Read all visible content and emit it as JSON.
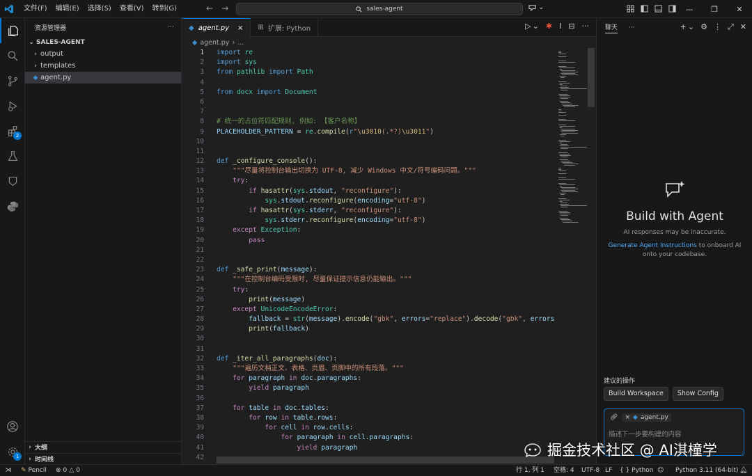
{
  "titlebar": {
    "menus": [
      "文件(F)",
      "编辑(E)",
      "选择(S)",
      "查看(V)",
      "转到(G)"
    ],
    "search_text": "sales-agent",
    "window_controls": [
      "minimize",
      "restore",
      "close"
    ]
  },
  "activitybar": {
    "items": [
      "explorer",
      "search",
      "source-control",
      "run-debug",
      "extensions",
      "testing",
      "remote",
      "python"
    ],
    "extensions_badge": "2",
    "accounts_badge": "1"
  },
  "sidebar": {
    "title": "资源管理器",
    "more": "···",
    "root": "SALES-AGENT",
    "items": [
      {
        "label": "output",
        "type": "folder"
      },
      {
        "label": "templates",
        "type": "folder"
      },
      {
        "label": "agent.py",
        "type": "file"
      }
    ],
    "outline_label": "大纲",
    "timeline_label": "时间线"
  },
  "editor": {
    "tabs": [
      {
        "label": "agent.py",
        "active": true,
        "close": "×"
      },
      {
        "label": "扩展: Python",
        "active": false
      }
    ],
    "breadcrumb": [
      "agent.py",
      "›",
      "..."
    ],
    "code_lines": [
      [
        [
          "kw",
          "import"
        ],
        [
          "p",
          " "
        ],
        [
          "cls",
          "re"
        ]
      ],
      [
        [
          "kw",
          "import"
        ],
        [
          "p",
          " "
        ],
        [
          "cls",
          "sys"
        ]
      ],
      [
        [
          "kw",
          "from"
        ],
        [
          "p",
          " "
        ],
        [
          "cls",
          "pathlib"
        ],
        [
          "p",
          " "
        ],
        [
          "kw",
          "import"
        ],
        [
          "p",
          " "
        ],
        [
          "cls",
          "Path"
        ]
      ],
      [],
      [
        [
          "kw",
          "from"
        ],
        [
          "p",
          " "
        ],
        [
          "cls",
          "docx"
        ],
        [
          "p",
          " "
        ],
        [
          "kw",
          "import"
        ],
        [
          "p",
          " "
        ],
        [
          "cls",
          "Document"
        ]
      ],
      [],
      [],
      [
        [
          "cmt",
          "# 统一的占位符匹配规则, 例如: 【客户名称】"
        ]
      ],
      [
        [
          "var",
          "PLACEHOLDER_PATTERN"
        ],
        [
          "p",
          " = "
        ],
        [
          "cls",
          "re"
        ],
        [
          "p",
          "."
        ],
        [
          "fn",
          "compile"
        ],
        [
          "p",
          "("
        ],
        [
          "kw",
          "r"
        ],
        [
          "str",
          "\""
        ],
        [
          "esc",
          "\\u3010"
        ],
        [
          "str",
          "(.*?)"
        ],
        [
          "esc",
          "\\u3011"
        ],
        [
          "str",
          "\""
        ],
        [
          "p",
          ")"
        ]
      ],
      [],
      [],
      [
        [
          "kw",
          "def"
        ],
        [
          "p",
          " "
        ],
        [
          "fn",
          "_configure_console"
        ],
        [
          "p",
          "():"
        ]
      ],
      [
        [
          "p",
          "    "
        ],
        [
          "str",
          "\"\"\"尽量将控制台输出切换为 UTF-8, 减少 Windows 中文/符号编码问题。\"\"\""
        ]
      ],
      [
        [
          "p",
          "    "
        ],
        [
          "ctl",
          "try"
        ],
        [
          "p",
          ":"
        ]
      ],
      [
        [
          "p",
          "        "
        ],
        [
          "ctl",
          "if"
        ],
        [
          "p",
          " "
        ],
        [
          "fn",
          "hasattr"
        ],
        [
          "p",
          "("
        ],
        [
          "cls",
          "sys"
        ],
        [
          "p",
          "."
        ],
        [
          "var",
          "stdout"
        ],
        [
          "p",
          ", "
        ],
        [
          "str",
          "\"reconfigure\""
        ],
        [
          "p",
          "):"
        ]
      ],
      [
        [
          "p",
          "            "
        ],
        [
          "cls",
          "sys"
        ],
        [
          "p",
          "."
        ],
        [
          "var",
          "stdout"
        ],
        [
          "p",
          "."
        ],
        [
          "fn",
          "reconfigure"
        ],
        [
          "p",
          "("
        ],
        [
          "var",
          "encoding"
        ],
        [
          "p",
          "="
        ],
        [
          "str",
          "\"utf-8\""
        ],
        [
          "p",
          ")"
        ]
      ],
      [
        [
          "p",
          "        "
        ],
        [
          "ctl",
          "if"
        ],
        [
          "p",
          " "
        ],
        [
          "fn",
          "hasattr"
        ],
        [
          "p",
          "("
        ],
        [
          "cls",
          "sys"
        ],
        [
          "p",
          "."
        ],
        [
          "var",
          "stderr"
        ],
        [
          "p",
          ", "
        ],
        [
          "str",
          "\"reconfigure\""
        ],
        [
          "p",
          "):"
        ]
      ],
      [
        [
          "p",
          "            "
        ],
        [
          "cls",
          "sys"
        ],
        [
          "p",
          "."
        ],
        [
          "var",
          "stderr"
        ],
        [
          "p",
          "."
        ],
        [
          "fn",
          "reconfigure"
        ],
        [
          "p",
          "("
        ],
        [
          "var",
          "encoding"
        ],
        [
          "p",
          "="
        ],
        [
          "str",
          "\"utf-8\""
        ],
        [
          "p",
          ")"
        ]
      ],
      [
        [
          "p",
          "    "
        ],
        [
          "ctl",
          "except"
        ],
        [
          "p",
          " "
        ],
        [
          "cls",
          "Exception"
        ],
        [
          "p",
          ":"
        ]
      ],
      [
        [
          "p",
          "        "
        ],
        [
          "ctl",
          "pass"
        ]
      ],
      [],
      [],
      [
        [
          "kw",
          "def"
        ],
        [
          "p",
          " "
        ],
        [
          "fn",
          "_safe_print"
        ],
        [
          "p",
          "("
        ],
        [
          "var",
          "message"
        ],
        [
          "p",
          "):"
        ]
      ],
      [
        [
          "p",
          "    "
        ],
        [
          "str",
          "\"\"\"在控制台编码受限时, 尽量保证提示信息仍能输出。\"\"\""
        ]
      ],
      [
        [
          "p",
          "    "
        ],
        [
          "ctl",
          "try"
        ],
        [
          "p",
          ":"
        ]
      ],
      [
        [
          "p",
          "        "
        ],
        [
          "fn",
          "print"
        ],
        [
          "p",
          "("
        ],
        [
          "var",
          "message"
        ],
        [
          "p",
          ")"
        ]
      ],
      [
        [
          "p",
          "    "
        ],
        [
          "ctl",
          "except"
        ],
        [
          "p",
          " "
        ],
        [
          "cls",
          "UnicodeEncodeError"
        ],
        [
          "p",
          ":"
        ]
      ],
      [
        [
          "p",
          "        "
        ],
        [
          "var",
          "fallback"
        ],
        [
          "p",
          " = "
        ],
        [
          "cls",
          "str"
        ],
        [
          "p",
          "("
        ],
        [
          "var",
          "message"
        ],
        [
          "p",
          ")."
        ],
        [
          "fn",
          "encode"
        ],
        [
          "p",
          "("
        ],
        [
          "str",
          "\"gbk\""
        ],
        [
          "p",
          ", "
        ],
        [
          "var",
          "errors"
        ],
        [
          "p",
          "="
        ],
        [
          "str",
          "\"replace\""
        ],
        [
          "p",
          ")."
        ],
        [
          "fn",
          "decode"
        ],
        [
          "p",
          "("
        ],
        [
          "str",
          "\"gbk\""
        ],
        [
          "p",
          ", "
        ],
        [
          "var",
          "errors"
        ]
      ],
      [
        [
          "p",
          "        "
        ],
        [
          "fn",
          "print"
        ],
        [
          "p",
          "("
        ],
        [
          "var",
          "fallback"
        ],
        [
          "p",
          ")"
        ]
      ],
      [],
      [],
      [
        [
          "kw",
          "def"
        ],
        [
          "p",
          " "
        ],
        [
          "fn",
          "_iter_all_paragraphs"
        ],
        [
          "p",
          "("
        ],
        [
          "var",
          "doc"
        ],
        [
          "p",
          "):"
        ]
      ],
      [
        [
          "p",
          "    "
        ],
        [
          "str",
          "\"\"\"遍历文档正文、表格、页眉、页脚中的所有段落。\"\"\""
        ]
      ],
      [
        [
          "p",
          "    "
        ],
        [
          "ctl",
          "for"
        ],
        [
          "p",
          " "
        ],
        [
          "var",
          "paragraph"
        ],
        [
          "p",
          " "
        ],
        [
          "ctl",
          "in"
        ],
        [
          "p",
          " "
        ],
        [
          "var",
          "doc"
        ],
        [
          "p",
          "."
        ],
        [
          "var",
          "paragraphs"
        ],
        [
          "p",
          ":"
        ]
      ],
      [
        [
          "p",
          "        "
        ],
        [
          "ctl",
          "yield"
        ],
        [
          "p",
          " "
        ],
        [
          "var",
          "paragraph"
        ]
      ],
      [],
      [
        [
          "p",
          "    "
        ],
        [
          "ctl",
          "for"
        ],
        [
          "p",
          " "
        ],
        [
          "var",
          "table"
        ],
        [
          "p",
          " "
        ],
        [
          "ctl",
          "in"
        ],
        [
          "p",
          " "
        ],
        [
          "var",
          "doc"
        ],
        [
          "p",
          "."
        ],
        [
          "var",
          "tables"
        ],
        [
          "p",
          ":"
        ]
      ],
      [
        [
          "p",
          "        "
        ],
        [
          "ctl",
          "for"
        ],
        [
          "p",
          " "
        ],
        [
          "var",
          "row"
        ],
        [
          "p",
          " "
        ],
        [
          "ctl",
          "in"
        ],
        [
          "p",
          " "
        ],
        [
          "var",
          "table"
        ],
        [
          "p",
          "."
        ],
        [
          "var",
          "rows"
        ],
        [
          "p",
          ":"
        ]
      ],
      [
        [
          "p",
          "            "
        ],
        [
          "ctl",
          "for"
        ],
        [
          "p",
          " "
        ],
        [
          "var",
          "cell"
        ],
        [
          "p",
          " "
        ],
        [
          "ctl",
          "in"
        ],
        [
          "p",
          " "
        ],
        [
          "var",
          "row"
        ],
        [
          "p",
          "."
        ],
        [
          "var",
          "cells"
        ],
        [
          "p",
          ":"
        ]
      ],
      [
        [
          "p",
          "                "
        ],
        [
          "ctl",
          "for"
        ],
        [
          "p",
          " "
        ],
        [
          "var",
          "paragraph"
        ],
        [
          "p",
          " "
        ],
        [
          "ctl",
          "in"
        ],
        [
          "p",
          " "
        ],
        [
          "var",
          "cell"
        ],
        [
          "p",
          "."
        ],
        [
          "var",
          "paragraphs"
        ],
        [
          "p",
          ":"
        ]
      ],
      [
        [
          "p",
          "                    "
        ],
        [
          "ctl",
          "yield"
        ],
        [
          "p",
          " "
        ],
        [
          "var",
          "paragraph"
        ]
      ],
      []
    ],
    "current_line": 1
  },
  "chat": {
    "title": "聊天",
    "more": "···",
    "heading": "Build with Agent",
    "subtitle": "AI responses may be inaccurate.",
    "desc_link": "Generate Agent Instructions",
    "desc_rest": " to onboard AI onto your codebase.",
    "suggested_label": "建议的操作",
    "suggested_buttons": [
      "Build Workspace",
      "Show Config"
    ],
    "attached_file": "agent.py",
    "input_placeholder": "描述下一步要构建的内容"
  },
  "statusbar": {
    "left": [
      {
        "icon": "pencil-icon",
        "label": "Pencil"
      },
      {
        "icon": "errors-icon",
        "label": "0"
      },
      {
        "icon": "warnings-icon",
        "label": "0"
      }
    ],
    "right": [
      "行 1, 列 1",
      "空格: 4",
      "UTF-8",
      "LF",
      "{ } Python",
      "Python 3.11 (64-bit)"
    ]
  },
  "watermark": {
    "text": "掘金技术社区 @ AI淇橦学"
  },
  "colors": {
    "accent": "#0078d4",
    "background": "#1f1f1f",
    "sidebar": "#181818"
  }
}
